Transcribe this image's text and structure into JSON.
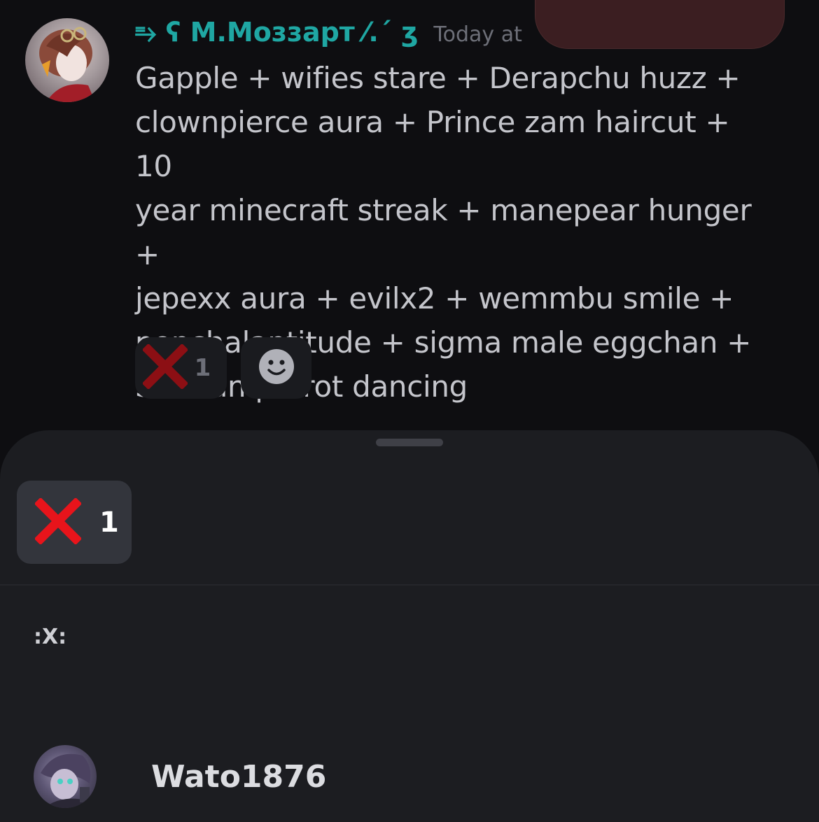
{
  "message": {
    "username": "⥱ ʕ M.Моззарт ⁄.ˊ ʒ",
    "timestamp": "Today at",
    "lines": [
      "Gapple + wifies stare + Derapchu huzz +",
      "clownpierce aura + Prince zam haircut + 10",
      "year minecraft streak + manepear hunger +",
      "jepexx aura + evilx2 + wemmbu smile +",
      "nonchalantitude + sigma male eggchan +",
      "Serbian parrot dancing"
    ],
    "reactions": [
      {
        "icon": "red-x-icon",
        "count": "1"
      },
      {
        "icon": "add-reaction-smiley-icon"
      }
    ]
  },
  "sheet": {
    "selected_reaction": {
      "icon": "red-x-icon",
      "count": "1"
    },
    "emoji_name": ":X:",
    "users": [
      {
        "name": "Wato1876"
      }
    ]
  },
  "colors": {
    "background": "#0e0e11",
    "sheet": "#1c1d21",
    "username": "#1fa7a3",
    "x_red": "#e8141b"
  }
}
